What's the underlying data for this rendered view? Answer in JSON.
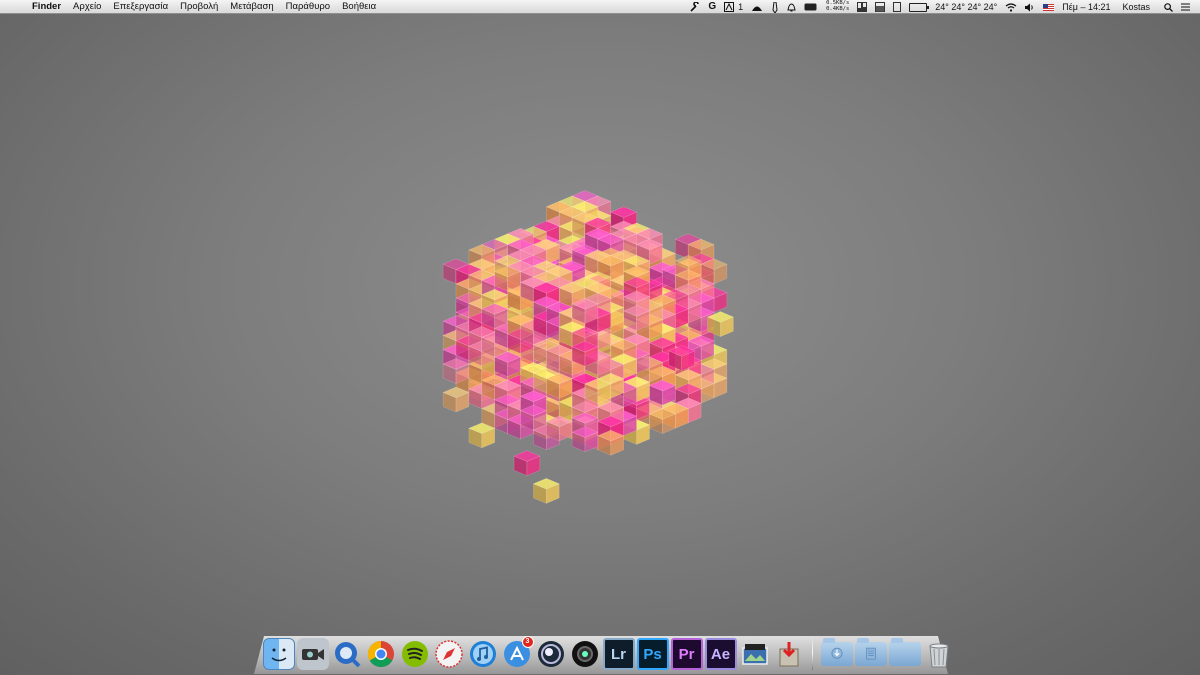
{
  "menubar": {
    "apple_glyph": "",
    "app_name": "Finder",
    "menus": [
      "Αρχείο",
      "Επεξεργασία",
      "Προβολή",
      "Μετάβαση",
      "Παράθυρο",
      "Βοήθεια"
    ],
    "status": {
      "net_up": "0.5KB/s",
      "net_down": "0.4KB/s",
      "extra_count": "1",
      "temperatures": "24° 24° 24° 24°",
      "clock": "Πέμ – 14:21",
      "user": "Kostas"
    },
    "tray_icons": [
      "wrench-icon",
      "g-icon",
      "adobe-icon",
      "butler-icon",
      "tie-icon",
      "bell-icon",
      "plug-icon",
      "cpu-monitor-icon",
      "network-monitor-icon",
      "memory-monitor-icon",
      "disk-icon",
      "battery-icon",
      "temperature-icon",
      "wifi-icon",
      "volume-icon",
      "flag-icon",
      "search-icon",
      "list-icon"
    ]
  },
  "dock": {
    "apps": [
      {
        "name": "finder-icon"
      },
      {
        "name": "facetime-icon"
      },
      {
        "name": "quicktime-icon"
      },
      {
        "name": "chrome-icon"
      },
      {
        "name": "spotify-icon"
      },
      {
        "name": "safari-icon"
      },
      {
        "name": "itunes-icon"
      },
      {
        "name": "app-store-icon",
        "badge": "3"
      },
      {
        "name": "cinema4d-icon"
      },
      {
        "name": "camera-icon"
      },
      {
        "name": "lightroom-icon",
        "label": "Lr"
      },
      {
        "name": "photoshop-icon",
        "label": "Ps"
      },
      {
        "name": "premiere-icon",
        "label": "Pr"
      },
      {
        "name": "after-effects-icon",
        "label": "Ae"
      },
      {
        "name": "photo-slideshow-icon"
      },
      {
        "name": "installer-icon"
      }
    ],
    "stacks": [
      "downloads-stack-icon",
      "documents-stack-icon",
      "applications-stack-icon"
    ],
    "trash": "trash-icon"
  },
  "colors": {
    "cube_magenta": "#ff2b8a",
    "cube_orange": "#ffa35a",
    "cube_yellow": "#ffd45e",
    "background_gray": "#7d7d7d"
  }
}
